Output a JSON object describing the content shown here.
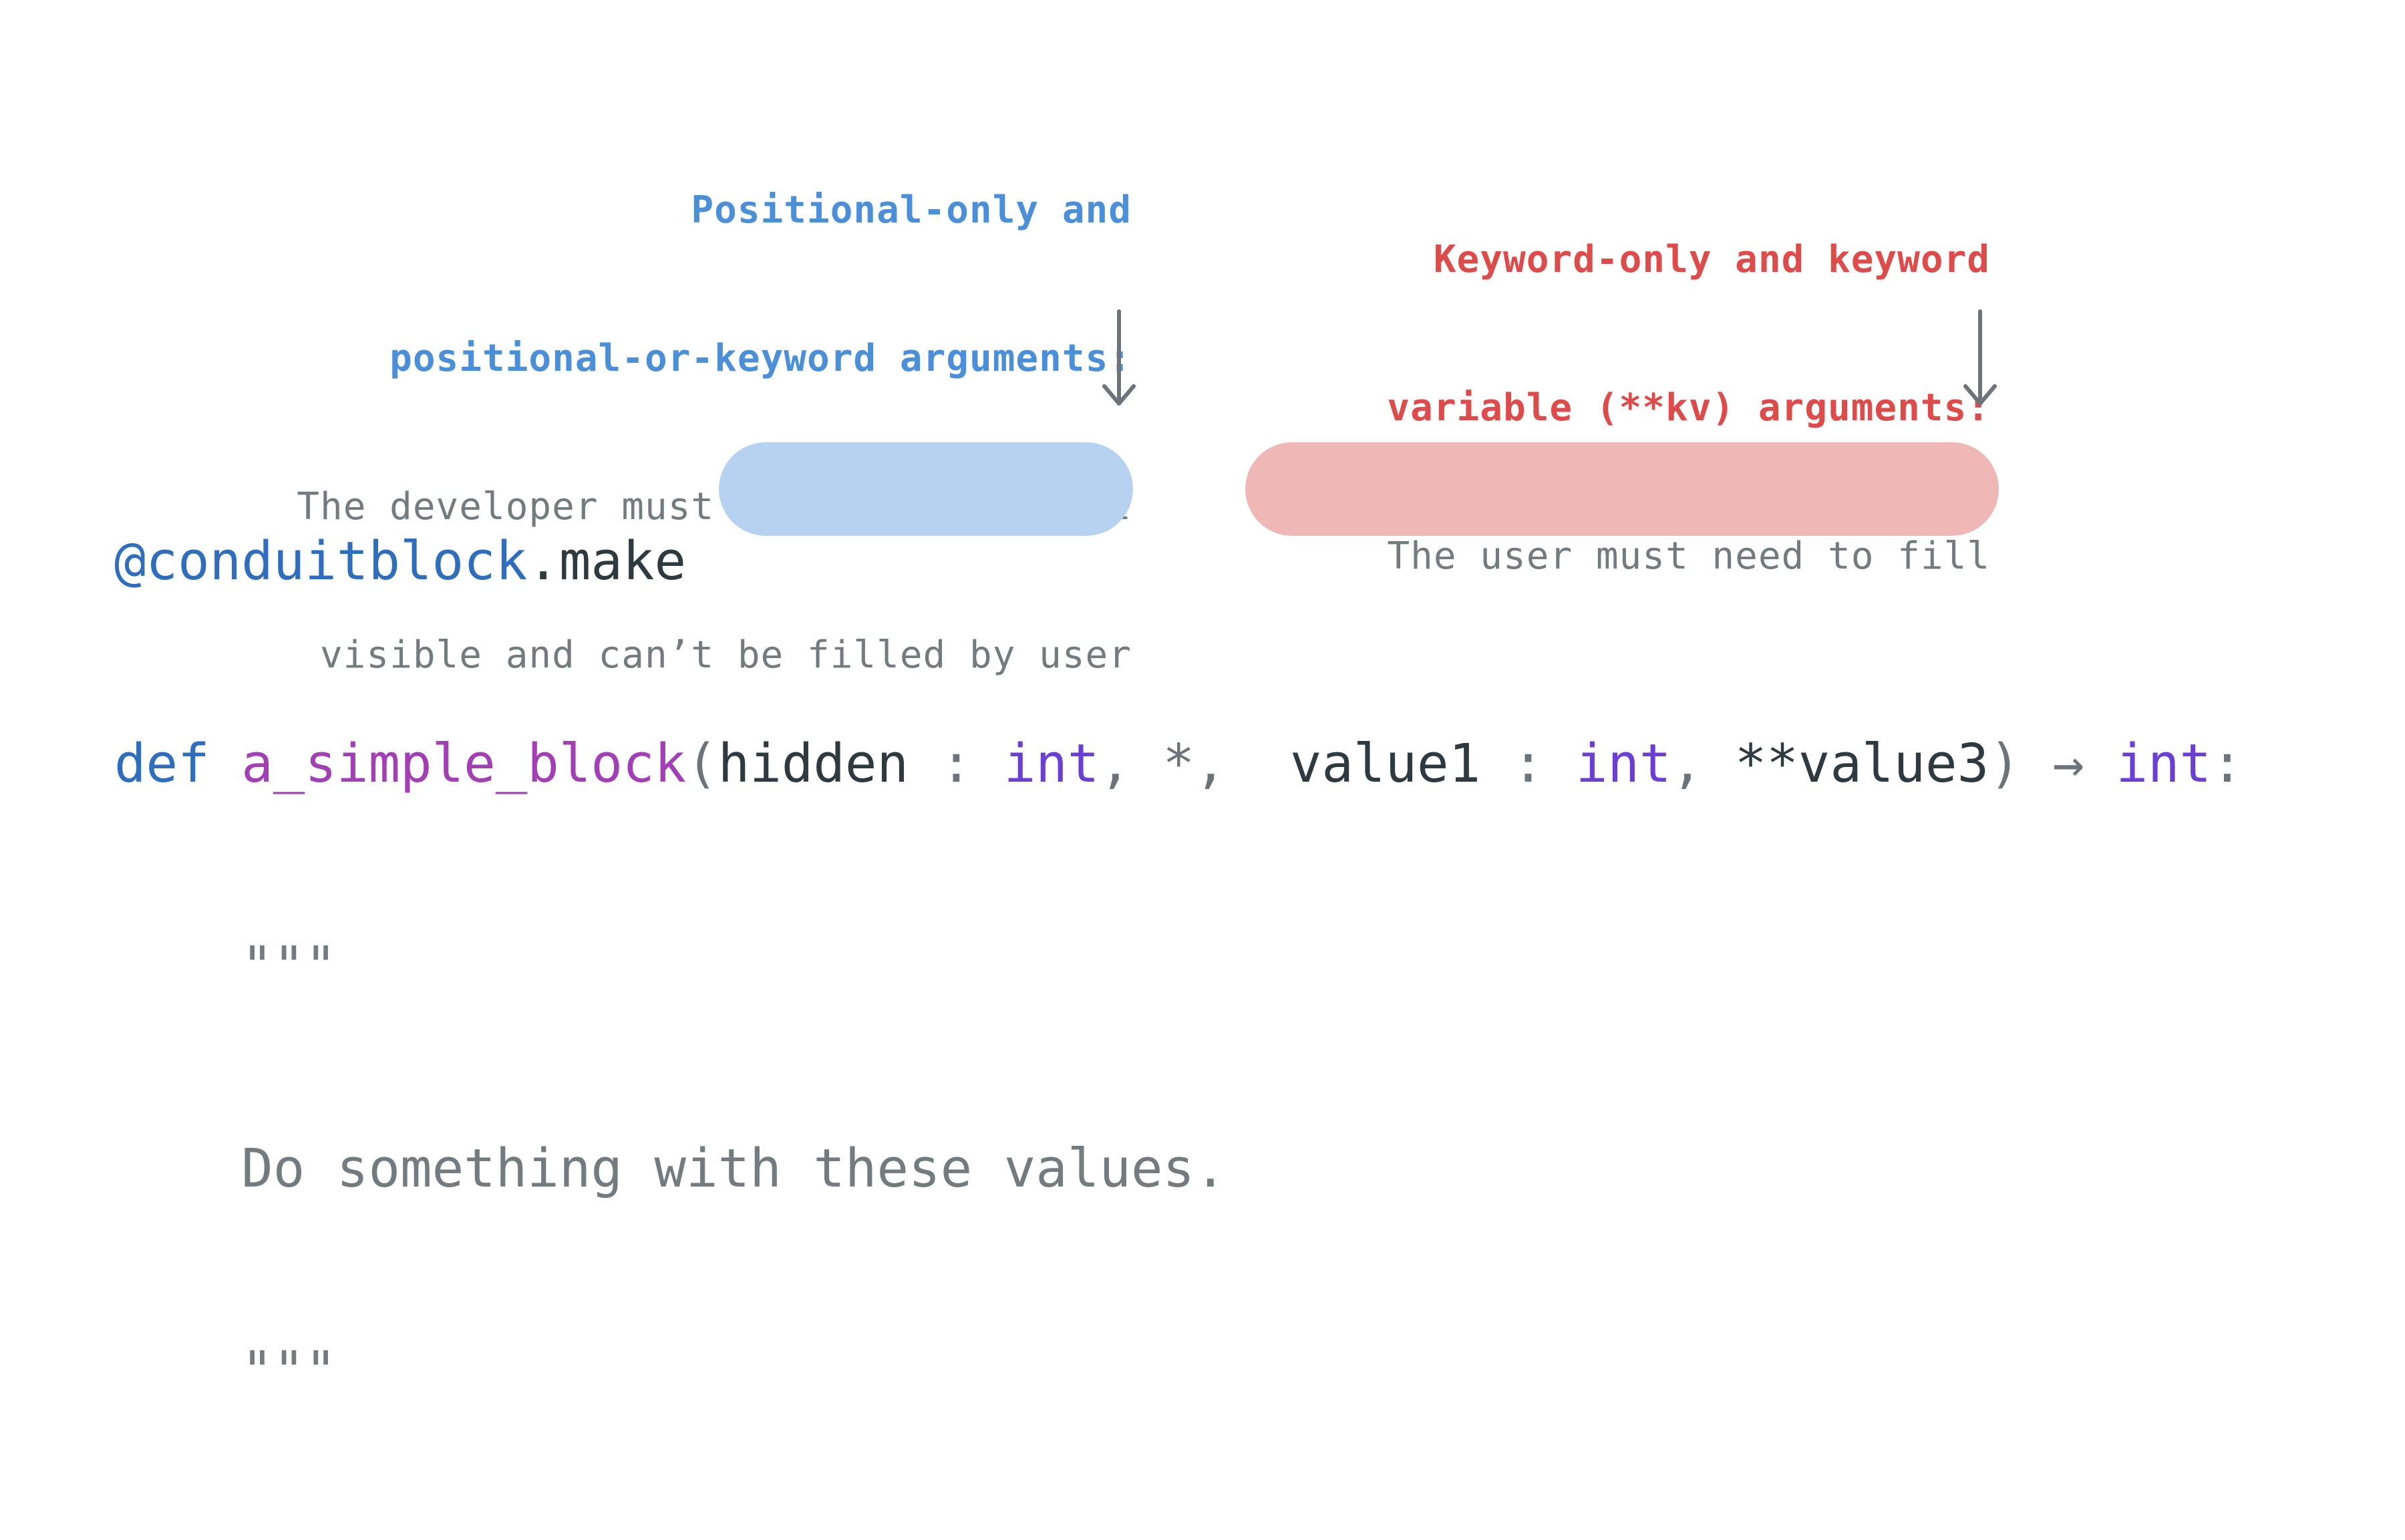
{
  "annotations": {
    "left": {
      "title_line1": "Positional-only and",
      "title_line2": "positional-or-keyword arguments:",
      "desc_line1": "The developer must need to fill, not",
      "desc_line2": "visible and can’t be filled by user"
    },
    "right": {
      "title_line1": "Keyword-only and keyword",
      "title_line2": "variable (**kv) arguments:",
      "desc_line1": "The user must need to fill"
    }
  },
  "code": {
    "decorator": "@conduitblock",
    "decorator_dot": ".",
    "decorator_attr": "make",
    "def_kw": "def",
    "func_name": "a_simple_block",
    "open_paren": "(",
    "param1_name": "hidden",
    "param1_colon": " : ",
    "param1_type": "int",
    "comma1": ",",
    "star": " *,",
    "param2_name": "value1",
    "param2_colon": " : ",
    "param2_type": "int",
    "comma2": ",",
    "param3": "**value3",
    "close_paren": ")",
    "arrow": "→",
    "return_type": "int",
    "final_colon": ":",
    "docstring_open": "\"\"\"",
    "docstring_text": "Do something with these values.",
    "docstring_close": "\"\"\""
  },
  "colors": {
    "blue_accent": "#4a8fd8",
    "red_accent": "#de4b4b",
    "blue_highlight": "#b7d2f0",
    "red_highlight": "#f0b7b7"
  }
}
